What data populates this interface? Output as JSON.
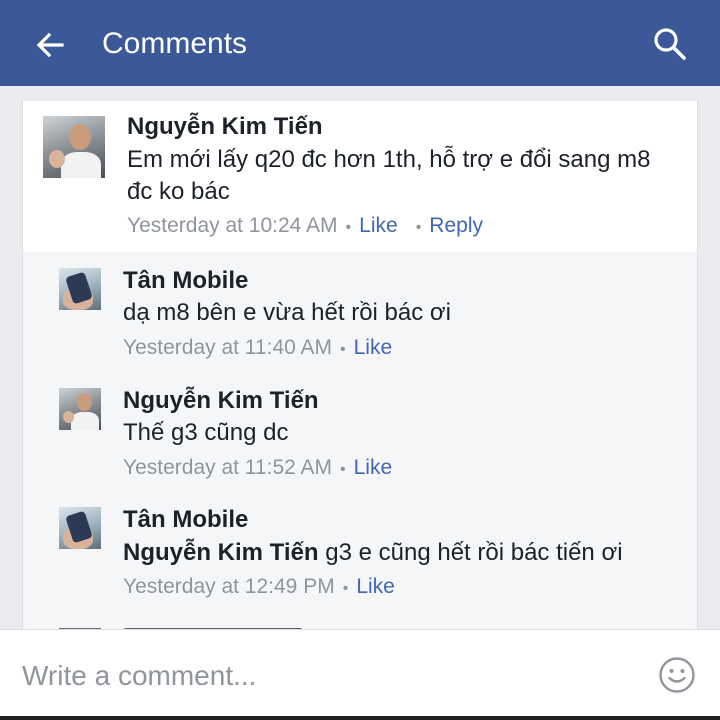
{
  "header": {
    "title": "Comments",
    "back_icon": "arrow-left-icon",
    "search_icon": "search-icon",
    "bar_color": "#3b5998"
  },
  "comments": [
    {
      "author": "Nguyễn Kim Tiến",
      "text": "Em mới lấy q20 đc hơn 1th, hỗ trợ e đổi sang m8 đc ko bác",
      "time": "Yesterday at 10:24 AM",
      "like_label": "Like",
      "reply_label": "Reply"
    }
  ],
  "replies": [
    {
      "author": "Tân Mobile",
      "text": "dạ m8 bên e vừa hết rồi bác ơi",
      "time": "Yesterday at 11:40 AM",
      "like_label": "Like"
    },
    {
      "author": "Nguyễn Kim Tiến",
      "text": "Thế g3 cũng dc",
      "time": "Yesterday at 11:52 AM",
      "like_label": "Like"
    },
    {
      "author": "Tân Mobile",
      "mention": "Nguyễn Kim Tiến",
      "text": " g3 e cũng hết rồi bác tiến ơi",
      "time": "Yesterday at 12:49 PM",
      "like_label": "Like"
    }
  ],
  "composer": {
    "placeholder": "Write a comment...",
    "emoji_icon": "smiley-icon"
  },
  "colors": {
    "link": "#4267b2",
    "meta": "#90949c",
    "text": "#1d2129"
  }
}
